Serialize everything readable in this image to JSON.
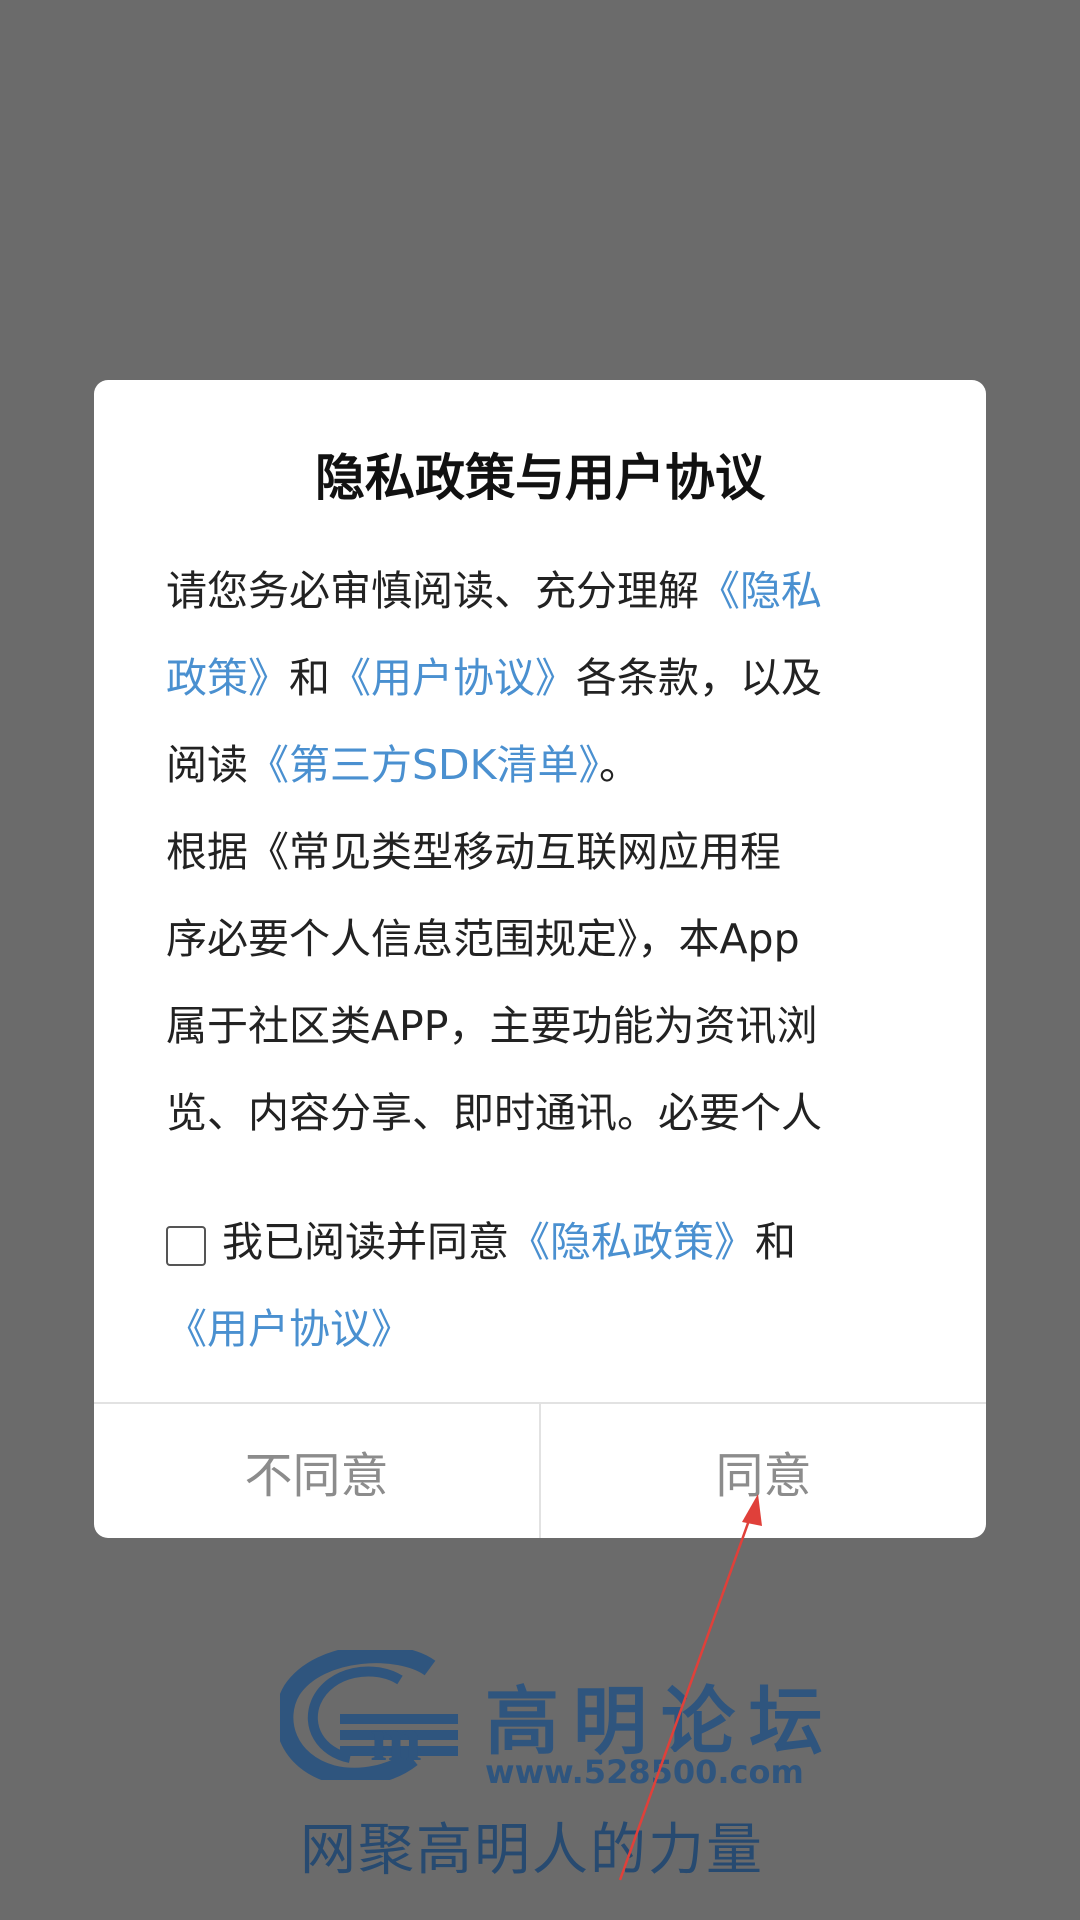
{
  "dialog": {
    "title": "隐私政策与用户协议",
    "intro": {
      "l1_text": "请您务必审慎阅读、充分理解",
      "l1_link": "《隐私",
      "l2_link": "政策》",
      "l2_text": "和",
      "l2_link2": "《用户协议》",
      "l2_text2": "各条款，以及",
      "l3_text": "阅读",
      "l3_link": "《第三方SDK清单》",
      "l3_text2": "。"
    },
    "body_lines": [
      "根据《常见类型移动互联网应用程",
      "序必要个人信息范围规定》，本App",
      "属于社区类APP，主要功能为资讯浏",
      "览、内容分享、即时通讯。必要个人"
    ],
    "consent": {
      "text": "我已阅读并同意",
      "privacy_link": "《隐私政策》",
      "and": "和",
      "user_link": "《用户协议》",
      "checked": false
    },
    "buttons": {
      "disagree": "不同意",
      "agree": "同意"
    }
  },
  "splash": {
    "logo_name": "高明论坛",
    "logo_url": "www.528500.com",
    "slogan": "网聚高明人的力量"
  },
  "colors": {
    "overlay": "#6b6b6b",
    "link": "#4a90d0",
    "brand": "#2f557e",
    "annotation_arrow": "#e0403a"
  }
}
